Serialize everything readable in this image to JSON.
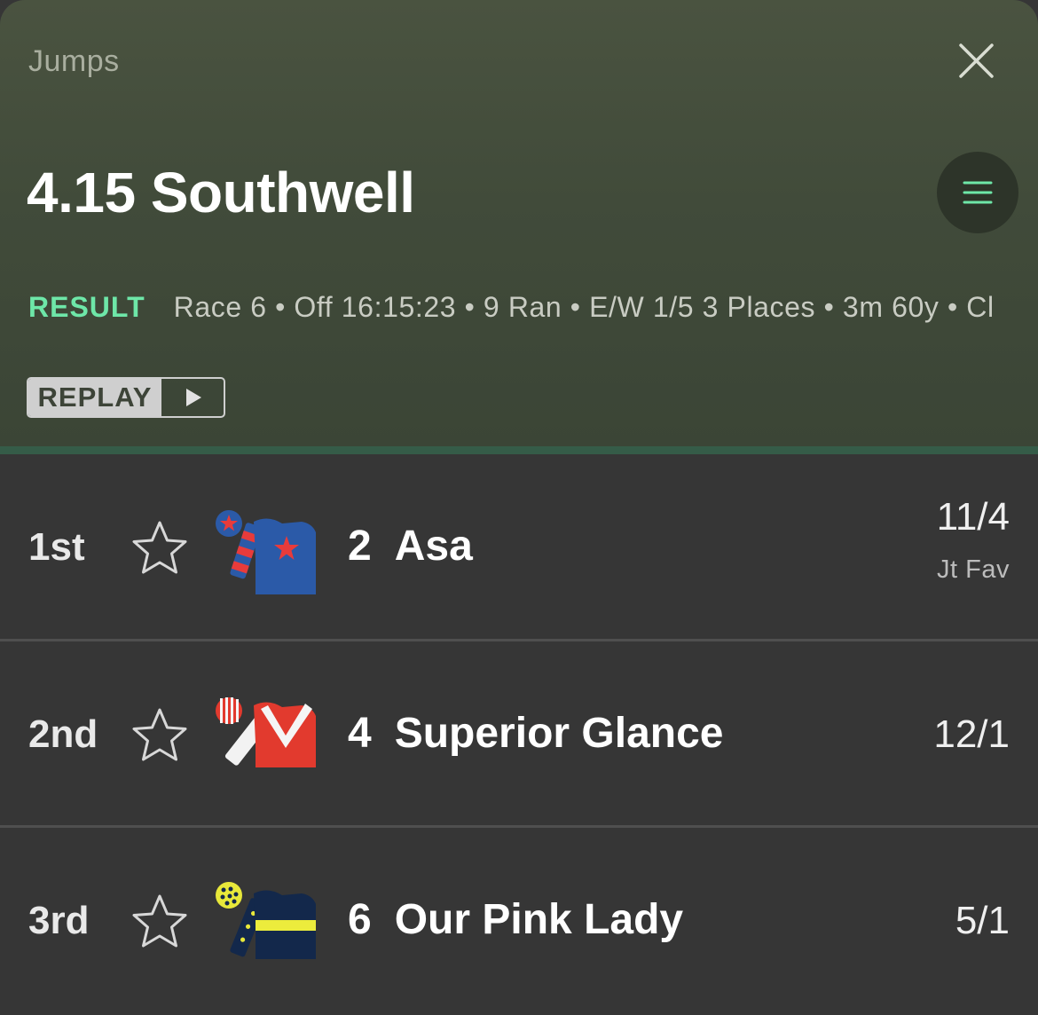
{
  "header": {
    "category": "Jumps",
    "title": "4.15 Southwell",
    "status": "RESULT",
    "info": "Race 6 • Off 16:15:23 • 9 Ran • E/W 1/5 3 Places • 3m 60y • Cl",
    "replay_label": "REPLAY",
    "close_icon": "close-icon",
    "menu_icon": "menu-icon",
    "play_icon": "play-icon"
  },
  "colors": {
    "header_bg": "#434c3b",
    "status_accent": "#6ee7a8",
    "row_bg": "#363636",
    "divider": "#355c48"
  },
  "runners": [
    {
      "position": "1st",
      "number": "2",
      "name": "Asa",
      "odds": "11/4",
      "odds_note": "Jt Fav",
      "silk": "blue silks with red star, red and blue hooped sleeves, blue cap with red star"
    },
    {
      "position": "2nd",
      "number": "4",
      "name": "Superior Glance",
      "odds": "12/1",
      "odds_note": "",
      "silk": "red silks with white chevron, white sleeves, red and white striped cap"
    },
    {
      "position": "3rd",
      "number": "6",
      "name": "Our Pink Lady",
      "odds": "5/1",
      "odds_note": "",
      "silk": "dark navy silks with yellow hoop, navy sleeves with yellow spots, yellow spotted cap"
    }
  ]
}
